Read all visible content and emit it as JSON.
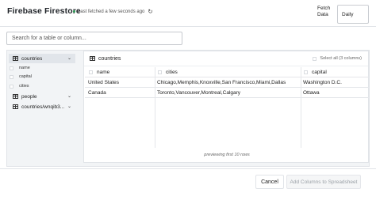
{
  "header": {
    "title": "Firebase Firestore",
    "fetch_status": "Last fetched a few seconds ago",
    "refresh_glyph": "↻",
    "fetch_label_line1": "Fetch",
    "fetch_label_line2": "Data",
    "fetch_select_value": "Daily"
  },
  "search": {
    "placeholder": "Search for a table or column..."
  },
  "sidebar": {
    "tables": [
      {
        "label": "countries",
        "chevron": "⌄"
      },
      {
        "label": "people",
        "chevron": "⌄"
      },
      {
        "label": "countries/wnqib3...",
        "chevron": "⌄"
      }
    ],
    "fields": [
      "name",
      "capital",
      "cities"
    ]
  },
  "table": {
    "name": "countries",
    "select_all": "Select all (3 columns)",
    "columns": [
      "name",
      "cities",
      "capital"
    ],
    "rows": [
      [
        "United States",
        "Chicago,Memphis,Knoxville,San Francisco,Miami,Dallas",
        "Washington D.C."
      ],
      [
        "Canada",
        "Toronto,Vancouver,Montreal,Calgary",
        "Ottawa"
      ]
    ],
    "preview_note": "previewing first 10 rows"
  },
  "footer": {
    "cancel_label": "Cancel",
    "add_label": "Add Columns to Spreadsheet"
  },
  "colors": {
    "status_green": "#2e9d57",
    "panel_bg": "#f2f4f6",
    "selected_bg": "#e1e5ea",
    "disabled_text": "#9aa0a6"
  }
}
